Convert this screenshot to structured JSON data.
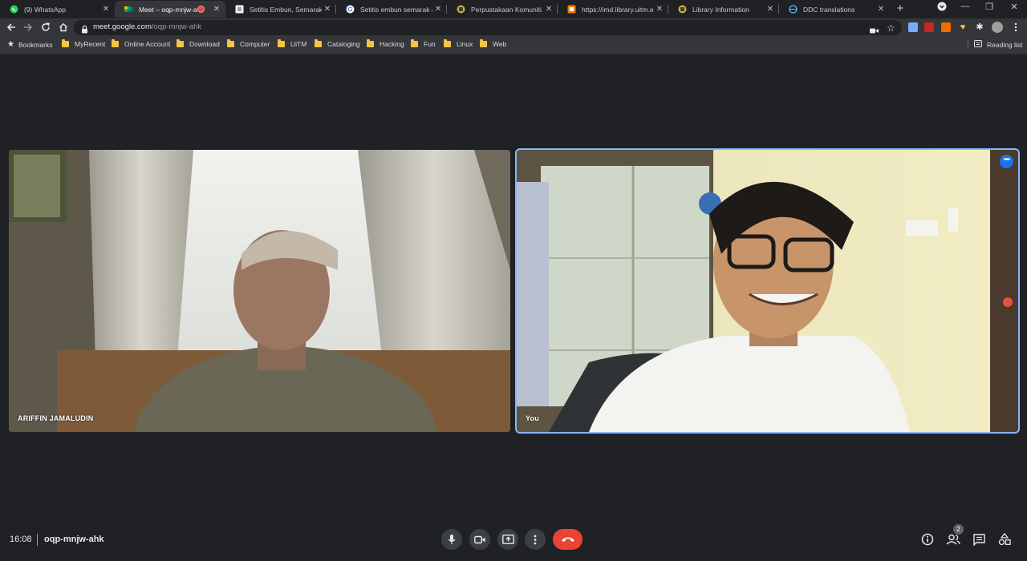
{
  "tabs": [
    {
      "title": "(9) WhatsApp",
      "icon": "whatsapp-icon",
      "active": false
    },
    {
      "title": "Meet – oqp-mnjw-ahk",
      "icon": "meet-icon",
      "active": true
    },
    {
      "title": "Setitis Embun, Semarak Ap",
      "icon": "page-icon",
      "active": false
    },
    {
      "title": "Setitis embun semarak ap",
      "icon": "google-icon",
      "active": false
    },
    {
      "title": "Perpustakaan Komuniti Al-",
      "icon": "library-icon",
      "active": false
    },
    {
      "title": "https://imd.library.uitm.edu",
      "icon": "page-icon",
      "active": false
    },
    {
      "title": "Library Information",
      "icon": "library-icon",
      "active": false
    },
    {
      "title": "DDC translations",
      "icon": "globe-icon",
      "active": false
    }
  ],
  "address": {
    "host": "meet.google.com",
    "path": "/oqp-mnjw-ahk"
  },
  "bookmarks": {
    "star_label": "Bookmarks",
    "folders": [
      "MyRecent",
      "Online Account",
      "Download",
      "Computer",
      "UiTM",
      "Cataloging",
      "Hacking",
      "Fun",
      "Linux",
      "Web"
    ],
    "reading_list": "Reading list"
  },
  "participants": [
    {
      "name": "ARIFFIN JAMALUDIN"
    },
    {
      "name": "You",
      "more_label": "•••"
    }
  ],
  "meeting": {
    "time": "16:08",
    "code": "oqp-mnjw-ahk",
    "participant_count": "2"
  },
  "colors": {
    "background": "#202124",
    "accent": "#8ab4f8",
    "hangup": "#ea4335",
    "badge_blue": "#1a73e8"
  }
}
